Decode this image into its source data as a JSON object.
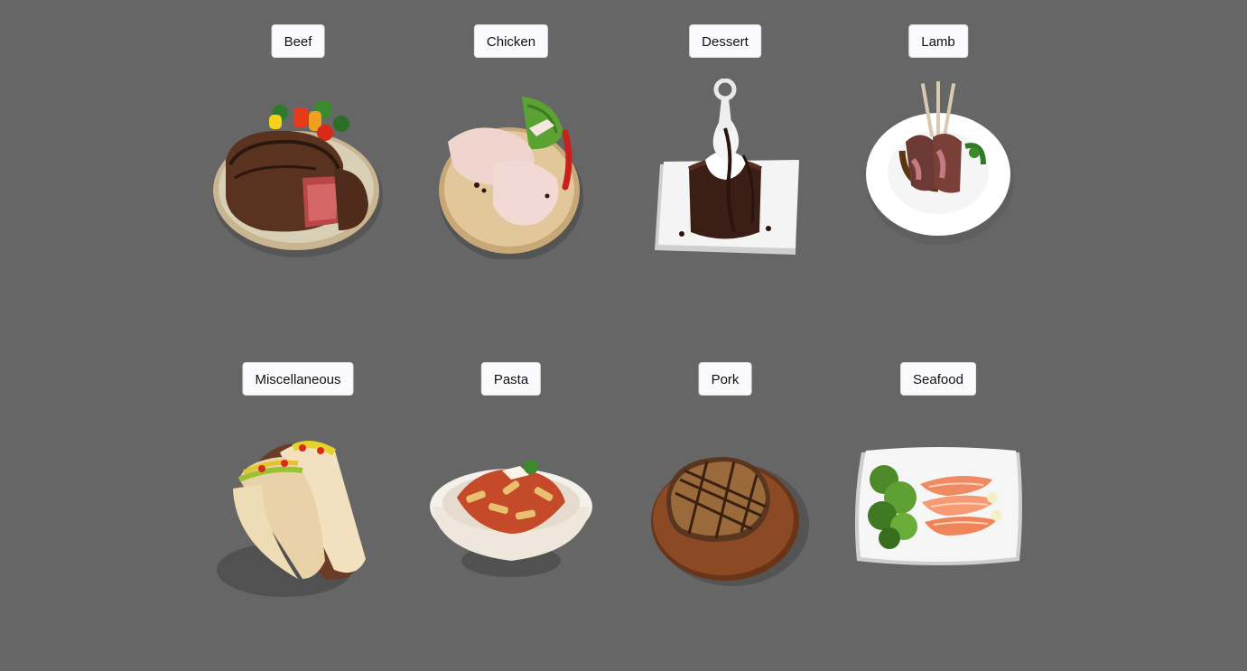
{
  "categories": [
    {
      "label": "Beef",
      "icon": "beef-steak-plate"
    },
    {
      "label": "Chicken",
      "icon": "chicken-legs-board"
    },
    {
      "label": "Dessert",
      "icon": "chocolate-lava-cake"
    },
    {
      "label": "Lamb",
      "icon": "lamb-chops-plate"
    },
    {
      "label": "Miscellaneous",
      "icon": "tacos"
    },
    {
      "label": "Pasta",
      "icon": "penne-pasta-bowl"
    },
    {
      "label": "Pork",
      "icon": "pork-chop-board"
    },
    {
      "label": "Seafood",
      "icon": "salmon-salad-plate"
    }
  ],
  "colors": {
    "background": "#666666",
    "button": "#fbfbfd",
    "text": "#111111"
  }
}
